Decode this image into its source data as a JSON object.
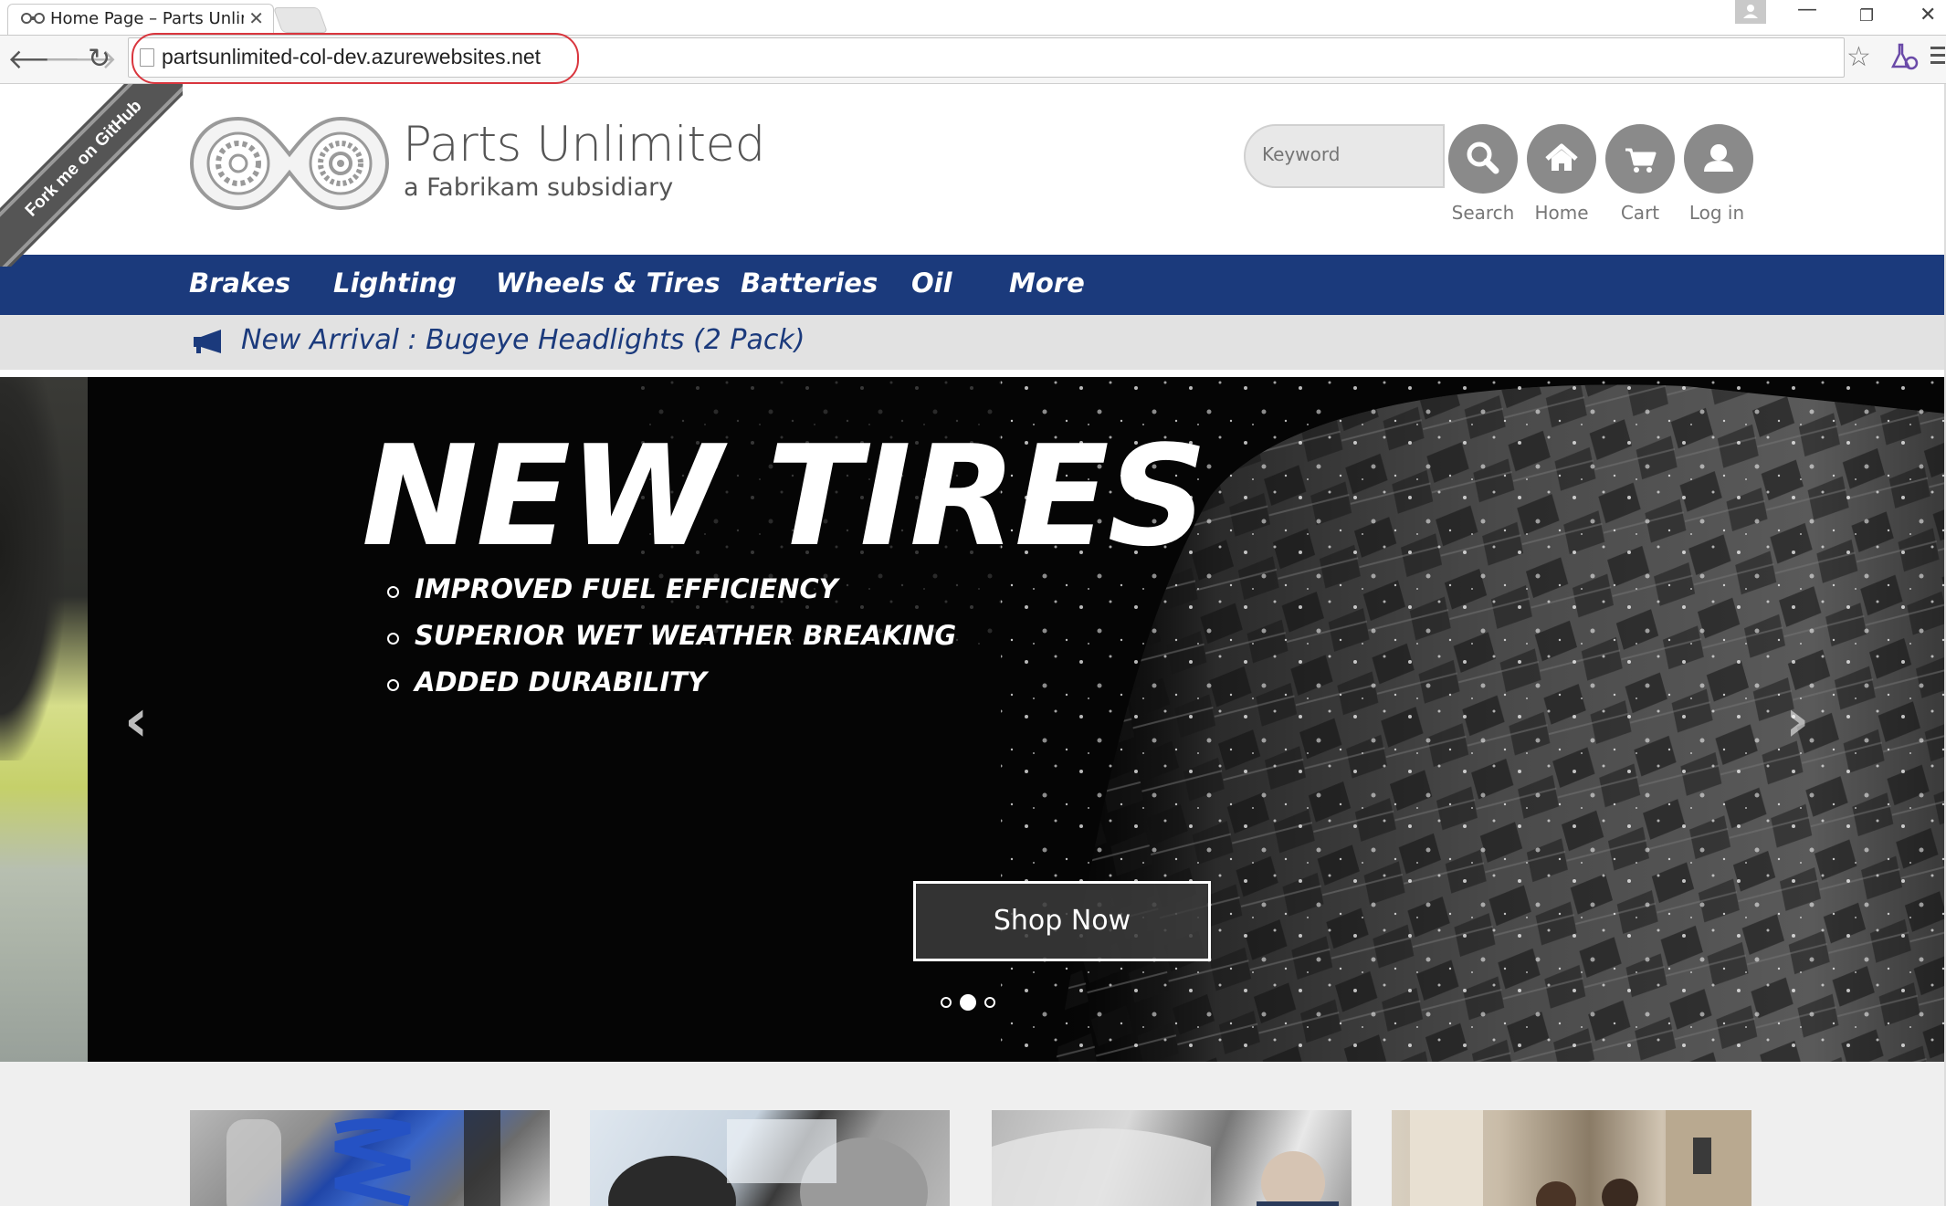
{
  "browser": {
    "tab_title": "Home Page – Parts Unlimi",
    "url": "partsunlimited-col-dev.azurewebsites.net"
  },
  "ribbon": {
    "label": "Fork me on GitHub"
  },
  "header": {
    "brand": "Parts Unlimited",
    "tagline": "a Fabrikam subsidiary",
    "search_placeholder": "Keyword",
    "actions": [
      {
        "label": "Search",
        "icon": "search-icon"
      },
      {
        "label": "Home",
        "icon": "home-icon"
      },
      {
        "label": "Cart",
        "icon": "cart-icon"
      },
      {
        "label": "Log in",
        "icon": "user-icon"
      }
    ]
  },
  "categories": [
    "Brakes",
    "Lighting",
    "Wheels & Tires",
    "Batteries",
    "Oil",
    "More"
  ],
  "announcement": {
    "icon": "megaphone-icon",
    "text": "New Arrival : Bugeye Headlights (2 Pack)"
  },
  "carousel": {
    "title": "NEW TIRES",
    "bullets": [
      "IMPROVED FUEL EFFICIENCY",
      "SUPERIOR WET WEATHER BREAKING",
      "ADDED DURABILITY"
    ],
    "cta": "Shop Now",
    "slide_count": 3,
    "active_slide": 2,
    "prev_icon": "chevron-left-icon",
    "next_icon": "chevron-right-icon"
  },
  "colors": {
    "nav_bg": "#1b3a7c",
    "announce_bg": "#e2e2e2",
    "announce_text": "#1b3a7c",
    "icon_circle": "#8a8a8a",
    "url_highlight": "#d9363e"
  }
}
